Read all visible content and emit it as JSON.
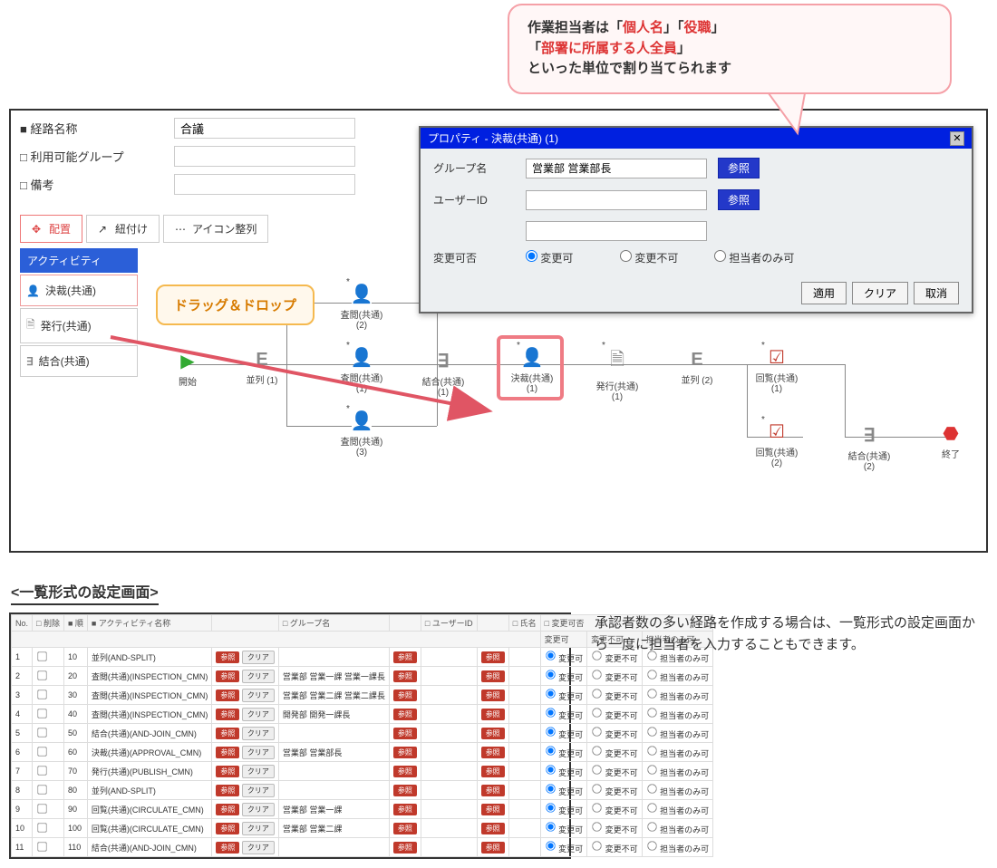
{
  "callout_top": {
    "prefix": "作業担当者は「",
    "t1": "個人名",
    "mid1": "」「",
    "t2": "役職",
    "mid2": "」\n「",
    "t3": "部署に所属する人全員",
    "suffix": "」\nといった単位で割り当てられます"
  },
  "form": {
    "route_label": "■ 経路名称",
    "route_value": "合議",
    "group_label": "□ 利用可能グループ",
    "group_value": "",
    "note_label": "□ 備考",
    "note_value": ""
  },
  "tabs": {
    "place": "配置",
    "link": "紐付け",
    "align": "アイコン整列"
  },
  "sidebar": {
    "head": "アクティビティ",
    "items": [
      {
        "icon": "person",
        "label": "決裁(共通)"
      },
      {
        "icon": "doc",
        "label": "発行(共通)"
      },
      {
        "icon": "join",
        "label": "結合(共通)"
      }
    ]
  },
  "dd_callout": "ドラッグ＆ドロップ",
  "nodes": {
    "start": "開始",
    "split1": "並列 (1)",
    "review1": "査閲(共通) (2)",
    "review2": "査閲(共通) (1)",
    "review3": "査閲(共通) (3)",
    "join1": "結合(共通) (1)",
    "approve": "決裁(共通) (1)",
    "issue": "発行(共通) (1)",
    "split2": "並列 (2)",
    "circ1": "回覧(共通) (1)",
    "circ2": "回覧(共通) (2)",
    "join2": "結合(共通) (2)",
    "end": "終了"
  },
  "prop": {
    "title": "プロパティ - 決裁(共通) (1)",
    "group_label": "グループ名",
    "group_value": "営業部 営業部長",
    "user_label": "ユーザーID",
    "user_value": "",
    "ref": "参照",
    "change_label": "変更可否",
    "r1": "変更可",
    "r2": "変更不可",
    "r3": "担当者のみ可",
    "apply": "適用",
    "clear": "クリア",
    "cancel": "取消"
  },
  "list_section_title": "<一覧形式の設定画面>",
  "list_headers": {
    "no": "No.",
    "del": "□ 削除",
    "ord": "■ 順",
    "act": "■ アクティビティ名称",
    "grp": "□ グループ名",
    "uid": "□ ユーザーID",
    "name": "□ 氏名",
    "chg": "□ 変更可否",
    "c1": "変更可",
    "c2": "変更不可",
    "c3": "担当者のみ可"
  },
  "list_rows": [
    {
      "no": 1,
      "ord": 10,
      "act": "並列(AND-SPLIT)",
      "grp": "",
      "uid": "",
      "name": ""
    },
    {
      "no": 2,
      "ord": 20,
      "act": "査閲(共通)(INSPECTION_CMN)",
      "grp": "営業部 営業一課 営業一課長",
      "uid": "",
      "name": ""
    },
    {
      "no": 3,
      "ord": 30,
      "act": "査閲(共通)(INSPECTION_CMN)",
      "grp": "営業部 営業二課 営業二課長",
      "uid": "",
      "name": ""
    },
    {
      "no": 4,
      "ord": 40,
      "act": "査閲(共通)(INSPECTION_CMN)",
      "grp": "開発部 開発一課長",
      "uid": "",
      "name": ""
    },
    {
      "no": 5,
      "ord": 50,
      "act": "結合(共通)(AND-JOIN_CMN)",
      "grp": "",
      "uid": "",
      "name": ""
    },
    {
      "no": 6,
      "ord": 60,
      "act": "決裁(共通)(APPROVAL_CMN)",
      "grp": "営業部 営業部長",
      "uid": "",
      "name": ""
    },
    {
      "no": 7,
      "ord": 70,
      "act": "発行(共通)(PUBLISH_CMN)",
      "grp": "",
      "uid": "",
      "name": ""
    },
    {
      "no": 8,
      "ord": 80,
      "act": "並列(AND-SPLIT)",
      "grp": "",
      "uid": "",
      "name": ""
    },
    {
      "no": 9,
      "ord": 90,
      "act": "回覧(共通)(CIRCULATE_CMN)",
      "grp": "営業部 営業一課",
      "uid": "",
      "name": ""
    },
    {
      "no": 10,
      "ord": 100,
      "act": "回覧(共通)(CIRCULATE_CMN)",
      "grp": "営業部 営業二課",
      "uid": "",
      "name": ""
    },
    {
      "no": 11,
      "ord": 110,
      "act": "結合(共通)(AND-JOIN_CMN)",
      "grp": "",
      "uid": "",
      "name": ""
    }
  ],
  "list_btn": {
    "ref": "参照",
    "clear": "クリア"
  },
  "list_desc": "承認者数の多い経路を作成する場合は、一覧形式の設定画面から一度に担当者を入力することもできます。"
}
